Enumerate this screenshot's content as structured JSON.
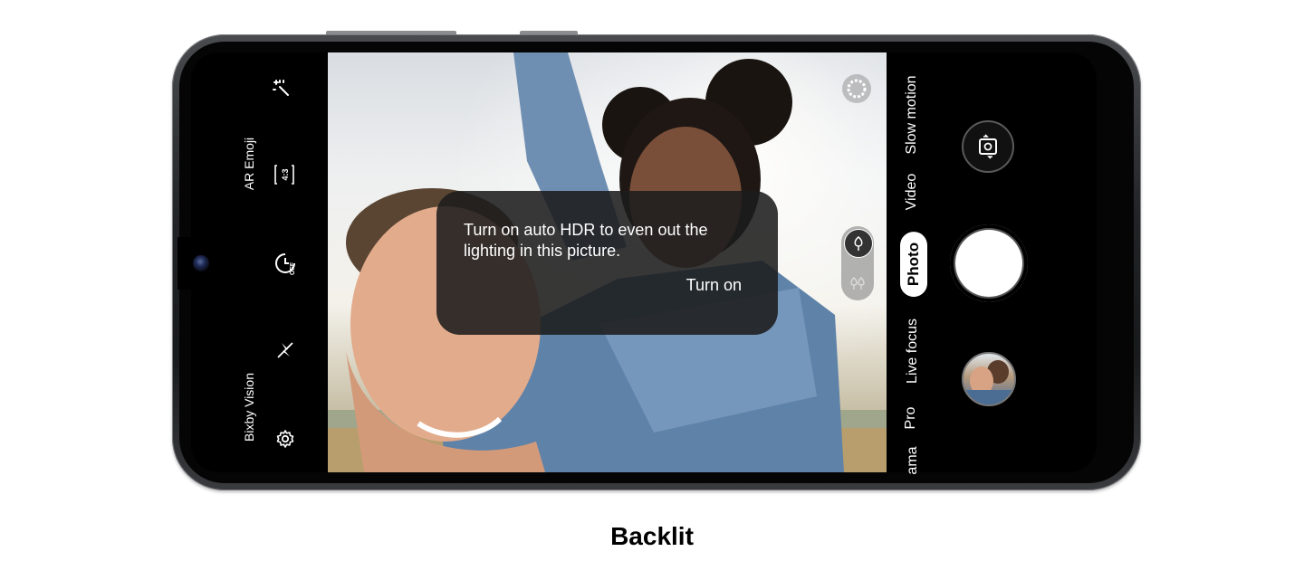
{
  "camera": {
    "left_controls": {
      "ar_emoji": "AR Emoji",
      "aspect_ratio": "4:3",
      "timer": "OFF",
      "bixby_vision": "Bixby Vision"
    },
    "hdr_prompt": {
      "message": "Turn on auto HDR to even out the lighting in this picture.",
      "action": "Turn on"
    },
    "modes": [
      "ama",
      "Pro",
      "Live focus",
      "Photo",
      "Video",
      "Slow motion"
    ],
    "active_mode": "Photo"
  },
  "caption": "Backlit"
}
